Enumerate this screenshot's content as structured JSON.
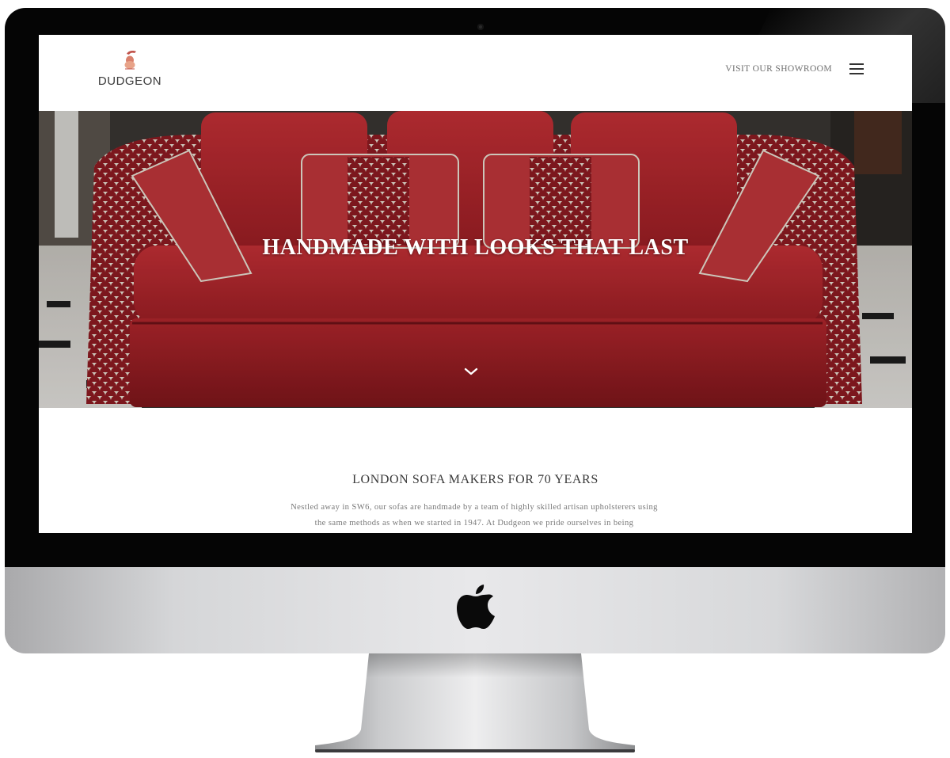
{
  "site": {
    "logo_text": "DUDGEON"
  },
  "header": {
    "showroom_link": "VISIT OUR SHOWROOM",
    "menu_icon": "hamburger-menu-icon"
  },
  "hero": {
    "title": "HANDMADE WITH LOOKS THAT LAST",
    "scroll_icon": "chevron-down-icon"
  },
  "intro": {
    "heading": "LONDON SOFA MAKERS FOR 70 YEARS",
    "body": "Nestled away in SW6, our sofas are handmade by a team of highly skilled artisan upholsterers using the same methods as when we started in 1947. At Dudgeon we pride ourselves in being"
  },
  "device": {
    "logo_icon": "apple-logo-icon"
  },
  "colors": {
    "sofa_red": "#b8262d",
    "bezel": "#050505",
    "heading_text": "#3a3a3a",
    "body_text": "#787878"
  }
}
